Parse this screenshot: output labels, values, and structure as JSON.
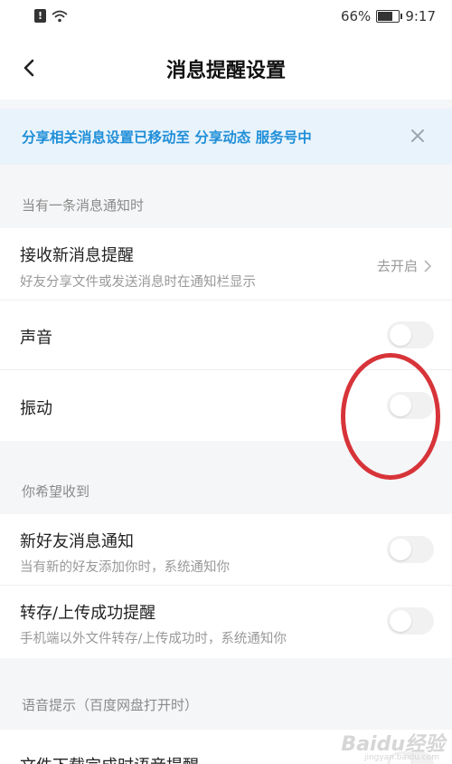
{
  "status": {
    "battery": "66%",
    "battery_level": 0.66,
    "time": "9:17"
  },
  "header": {
    "title": "消息提醒设置"
  },
  "notice": {
    "text": "分享相关消息设置已移动至 分享动态 服务号中"
  },
  "sections": {
    "s1": "当有一条消息通知时",
    "s2": "你希望收到",
    "s3": "语音提示（百度网盘打开时）"
  },
  "rows": {
    "new_msg": {
      "title": "接收新消息提醒",
      "subtitle": "好友分享文件或发送消息时在通知栏显示",
      "action": "去开启"
    },
    "sound": {
      "title": "声音",
      "on": false
    },
    "vibrate": {
      "title": "振动",
      "on": false
    },
    "new_friend": {
      "title": "新好友消息通知",
      "subtitle": "当有新的好友添加你时，系统通知你",
      "on": false
    },
    "transfer": {
      "title": "转存/上传成功提醒",
      "subtitle": "手机端以外文件转存/上传成功时，系统通知你",
      "on": false
    },
    "download": {
      "title": "文件下载完成时语音提醒"
    }
  },
  "watermark": {
    "text": "Baidu经验",
    "sub": "jingyan.baidu.com"
  },
  "colors": {
    "accent": "#1f8fd8",
    "annotation": "#d7343a"
  }
}
